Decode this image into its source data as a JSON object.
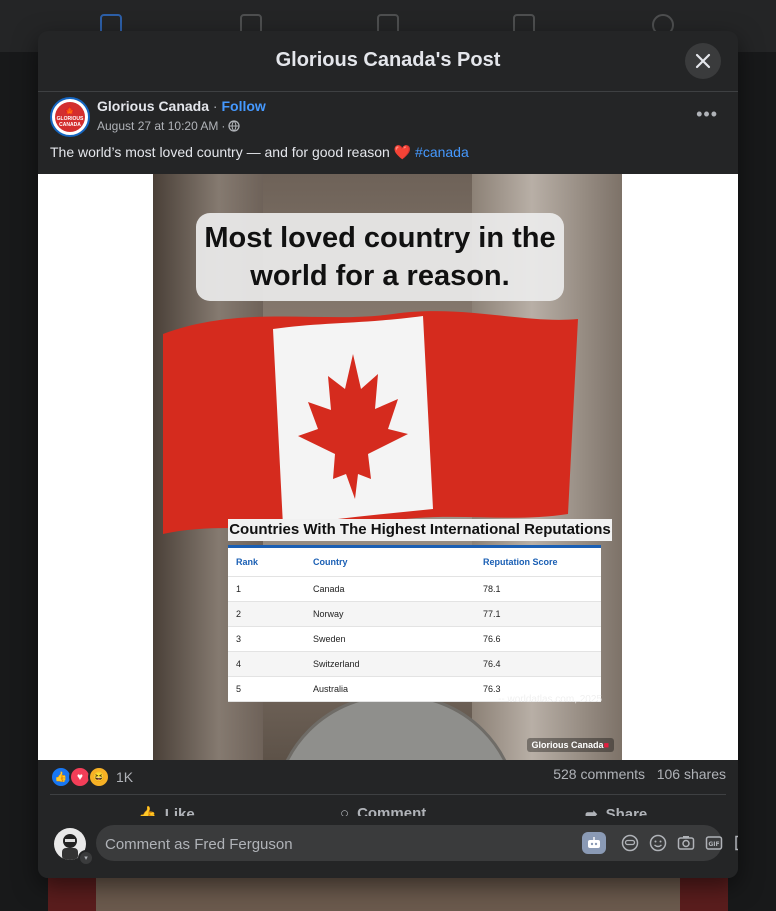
{
  "modal": {
    "title": "Glorious Canada's Post"
  },
  "post": {
    "author": "Glorious Canada",
    "separator": " · ",
    "follow_label": "Follow",
    "timestamp": "August 27 at 10:20 AM",
    "meta_separator": "·",
    "avatar_text_1": "GLORIOUS",
    "avatar_text_2": "CANADA",
    "caption_text": "The world’s most loved country — and for good reason",
    "caption_emoji": "❤️",
    "hashtag": "#canada",
    "more_label": "•••"
  },
  "image": {
    "headline": "Most loved country in the world for a reason.",
    "table_title": "Countries With The Highest International Reputations",
    "columns": [
      "Rank",
      "Country",
      "Reputation Score"
    ],
    "rows": [
      {
        "rank": "1",
        "country": "Canada",
        "score": "78.1"
      },
      {
        "rank": "2",
        "country": "Norway",
        "score": "77.1"
      },
      {
        "rank": "3",
        "country": "Sweden",
        "score": "76.6"
      },
      {
        "rank": "4",
        "country": "Switzerland",
        "score": "76.4"
      },
      {
        "rank": "5",
        "country": "Australia",
        "score": "76.3"
      }
    ],
    "source": "-- worldatlas.com, 2025",
    "brand": "Glorious Canada"
  },
  "stats": {
    "reaction_count": "1K",
    "comments": "528 comments",
    "shares": "106 shares"
  },
  "actions": {
    "like": "Like",
    "comment": "Comment",
    "share": "Share"
  },
  "composer": {
    "placeholder": "Comment as Fred Ferguson"
  },
  "colors": {
    "accent": "#4599ff",
    "like": "#1877f2",
    "love": "#f33e58",
    "haha": "#f7b125",
    "flag_red": "#d52b1e"
  },
  "icons": [
    "home-icon",
    "video-icon",
    "marketplace-icon",
    "groups-icon",
    "close-icon",
    "globe-icon",
    "more-icon",
    "like-reaction-icon",
    "love-reaction-icon",
    "haha-reaction-icon",
    "like-icon",
    "comment-icon",
    "share-icon",
    "avatar-bot-icon",
    "gif-icon",
    "sticker-icon",
    "emoji-icon",
    "camera-icon"
  ]
}
